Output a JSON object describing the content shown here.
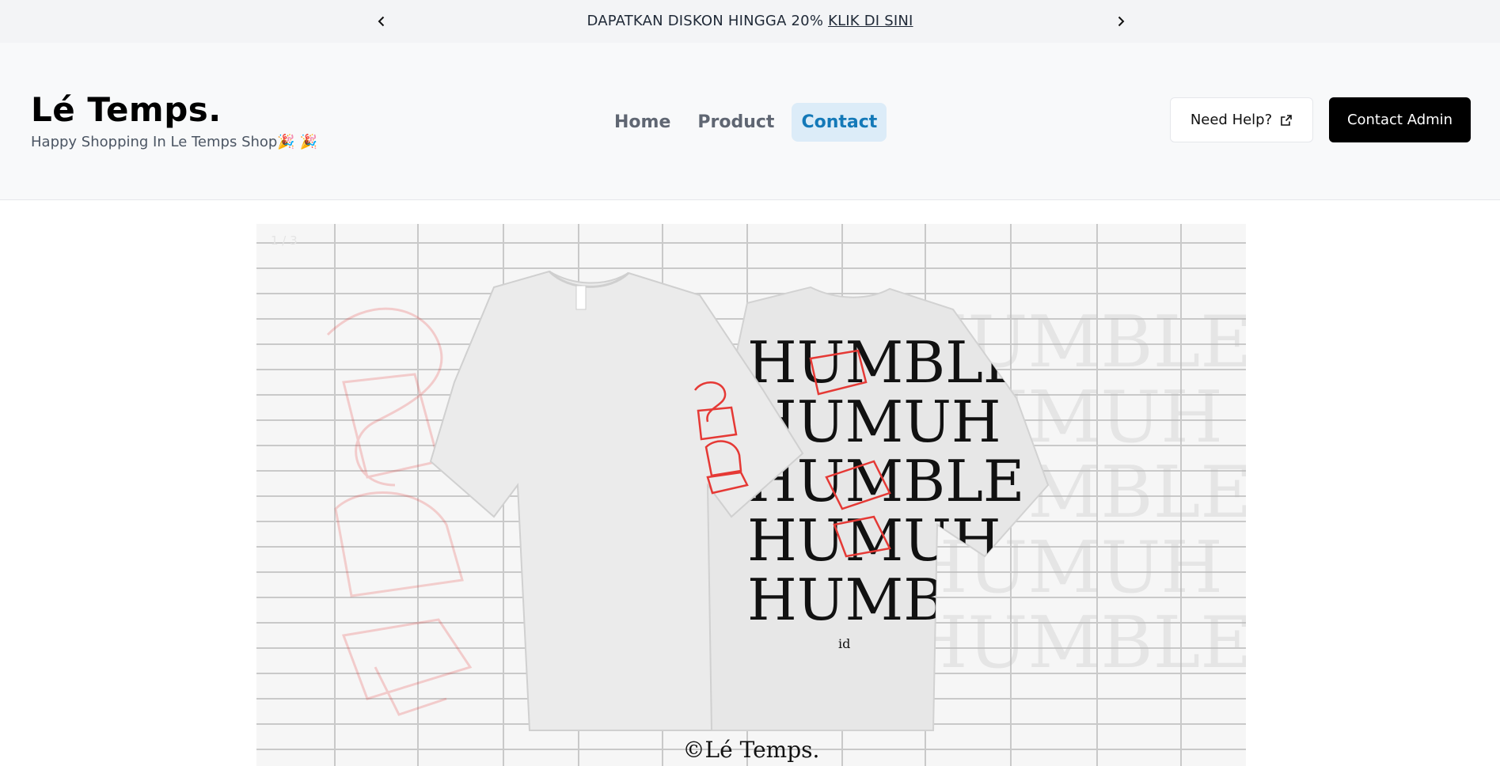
{
  "announcement": {
    "text": "DAPATKAN DISKON HINGGA 20%",
    "link": "KLIK DI SINI"
  },
  "header": {
    "brand": "Lé Temps.",
    "tagline": "Happy Shopping In Le Temps Shop🎉 🎉",
    "nav": [
      "Home",
      "Product",
      "Contact"
    ],
    "active_nav": "Contact",
    "help_button": "Need Help?",
    "admin_button": "Contact Admin"
  },
  "hero": {
    "counter": "1 / 3",
    "back_print": [
      "HUMBLE",
      "HUMUH",
      "HUMBLE",
      "HUMUH",
      "HUMBLE"
    ],
    "back_caption": "id",
    "copyright": "©Lé Temps.",
    "accent_color": "#e53935"
  }
}
